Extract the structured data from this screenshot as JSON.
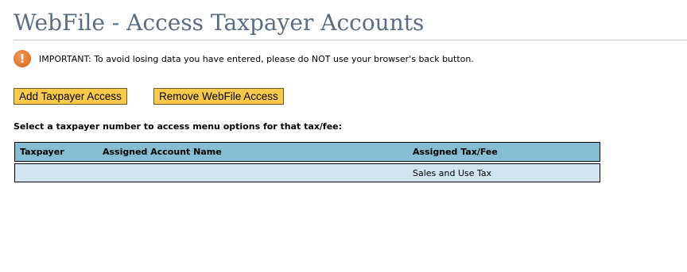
{
  "page": {
    "title": "WebFile - Access Taxpayer Accounts"
  },
  "notice": {
    "icon": "warning-icon",
    "text": "IMPORTANT:  To avoid losing data you have entered, please do NOT use your browser's back button."
  },
  "actions": {
    "add_label": "Add Taxpayer Access",
    "remove_label": "Remove WebFile Access"
  },
  "instruction": "Select a taxpayer number to access menu options for that tax/fee:",
  "table": {
    "headers": [
      "Taxpayer",
      "Assigned Account Name",
      "Assigned Tax/Fee"
    ],
    "rows": [
      {
        "taxpayer": "",
        "account_name": "",
        "tax_fee": "Sales and Use Tax"
      }
    ]
  },
  "colors": {
    "title": "#5a6e82",
    "button_bg": "#fbc94a",
    "header_bg": "#86bdd3",
    "row_bg": "#d2e5ee",
    "warning": "#e07030"
  }
}
